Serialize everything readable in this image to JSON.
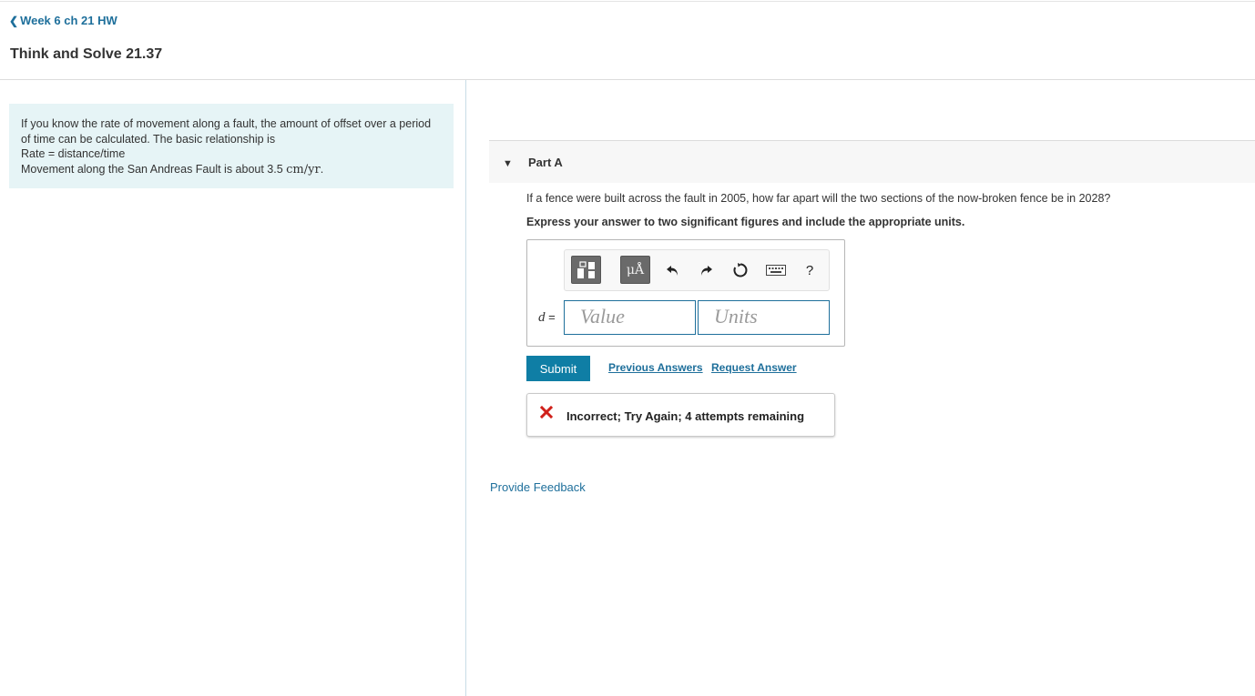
{
  "nav": {
    "back_label": "Week 6 ch 21 HW"
  },
  "page": {
    "title": "Think and Solve 21.37"
  },
  "intro": {
    "line1": "If you know the rate of movement along a fault, the amount of offset over a period of time can be calculated. The basic relationship is",
    "line2": "Rate = distance/time",
    "line3_prefix": "Movement along the San Andreas Fault is about 3.5 ",
    "line3_unit": "cm/yr",
    "line3_suffix": "."
  },
  "part": {
    "label": "Part A",
    "question": "If a fence were built across the fault in 2005, how far apart will the two sections of the now-broken fence be in 2028?",
    "instruction": "Express your answer to two significant figures and include the appropriate units."
  },
  "answer": {
    "variable": "d",
    "equals": " =",
    "value_placeholder": "Value",
    "units_placeholder": "Units"
  },
  "toolbar": {
    "units_symbol": "μÅ",
    "help_label": "?",
    "icons": [
      "templates-icon",
      "units-icon",
      "undo-icon",
      "redo-icon",
      "reset-icon",
      "keyboard-icon",
      "help-icon"
    ]
  },
  "actions": {
    "submit_label": "Submit",
    "previous_answers_label": "Previous Answers",
    "request_answer_label": "Request Answer"
  },
  "feedback": {
    "message": "Incorrect; Try Again; 4 attempts remaining",
    "status_color": "#d0201a"
  },
  "footer": {
    "provide_feedback_label": "Provide Feedback"
  },
  "colors": {
    "accent": "#1e6f9b",
    "submit": "#0f7ea5",
    "intro_bg": "#e6f4f6"
  }
}
